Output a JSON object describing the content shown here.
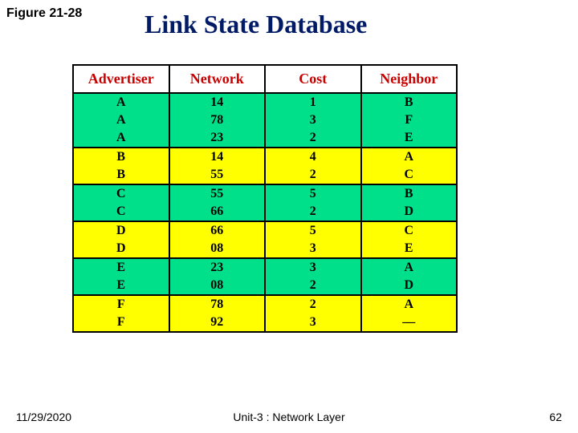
{
  "figure_label": "Figure 21-28",
  "title": "Link State Database",
  "headers": [
    "Advertiser",
    "Network",
    "Cost",
    "Neighbor"
  ],
  "groups": [
    {
      "color": "green",
      "rows": [
        {
          "advertiser": "A",
          "network": "14",
          "cost": "1",
          "neighbor": "B"
        },
        {
          "advertiser": "A",
          "network": "78",
          "cost": "3",
          "neighbor": "F"
        },
        {
          "advertiser": "A",
          "network": "23",
          "cost": "2",
          "neighbor": "E"
        }
      ]
    },
    {
      "color": "yellow",
      "rows": [
        {
          "advertiser": "B",
          "network": "14",
          "cost": "4",
          "neighbor": "A"
        },
        {
          "advertiser": "B",
          "network": "55",
          "cost": "2",
          "neighbor": "C"
        }
      ]
    },
    {
      "color": "green",
      "rows": [
        {
          "advertiser": "C",
          "network": "55",
          "cost": "5",
          "neighbor": "B"
        },
        {
          "advertiser": "C",
          "network": "66",
          "cost": "2",
          "neighbor": "D"
        }
      ]
    },
    {
      "color": "yellow",
      "rows": [
        {
          "advertiser": "D",
          "network": "66",
          "cost": "5",
          "neighbor": "C"
        },
        {
          "advertiser": "D",
          "network": "08",
          "cost": "3",
          "neighbor": "E"
        }
      ]
    },
    {
      "color": "green",
      "rows": [
        {
          "advertiser": "E",
          "network": "23",
          "cost": "3",
          "neighbor": "A"
        },
        {
          "advertiser": "E",
          "network": "08",
          "cost": "2",
          "neighbor": "D"
        }
      ]
    },
    {
      "color": "yellow",
      "rows": [
        {
          "advertiser": "F",
          "network": "78",
          "cost": "2",
          "neighbor": "A"
        },
        {
          "advertiser": "F",
          "network": "92",
          "cost": "3",
          "neighbor": "—"
        }
      ]
    }
  ],
  "footer": {
    "date": "11/29/2020",
    "center": "Unit-3 : Network Layer",
    "page": "62"
  }
}
